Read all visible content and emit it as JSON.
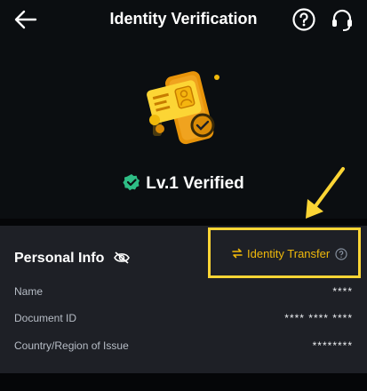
{
  "header": {
    "title": "Identity Verification"
  },
  "status": {
    "level_text": "Lv.1 Verified"
  },
  "personal_info": {
    "title": "Personal Info",
    "identity_transfer_label": "Identity Transfer",
    "rows": [
      {
        "label": "Name",
        "value": "****"
      },
      {
        "label": "Document ID",
        "value": "**** **** ****"
      },
      {
        "label": "Country/Region of Issue",
        "value": "********"
      }
    ]
  },
  "colors": {
    "accent": "#f0b90b",
    "verified": "#2ebd85",
    "annotation": "#fcd535"
  },
  "icons": [
    "back-arrow-icon",
    "help-circle-icon",
    "headset-icon",
    "verified-badge-icon",
    "eye-off-icon",
    "swap-icon",
    "question-icon"
  ]
}
